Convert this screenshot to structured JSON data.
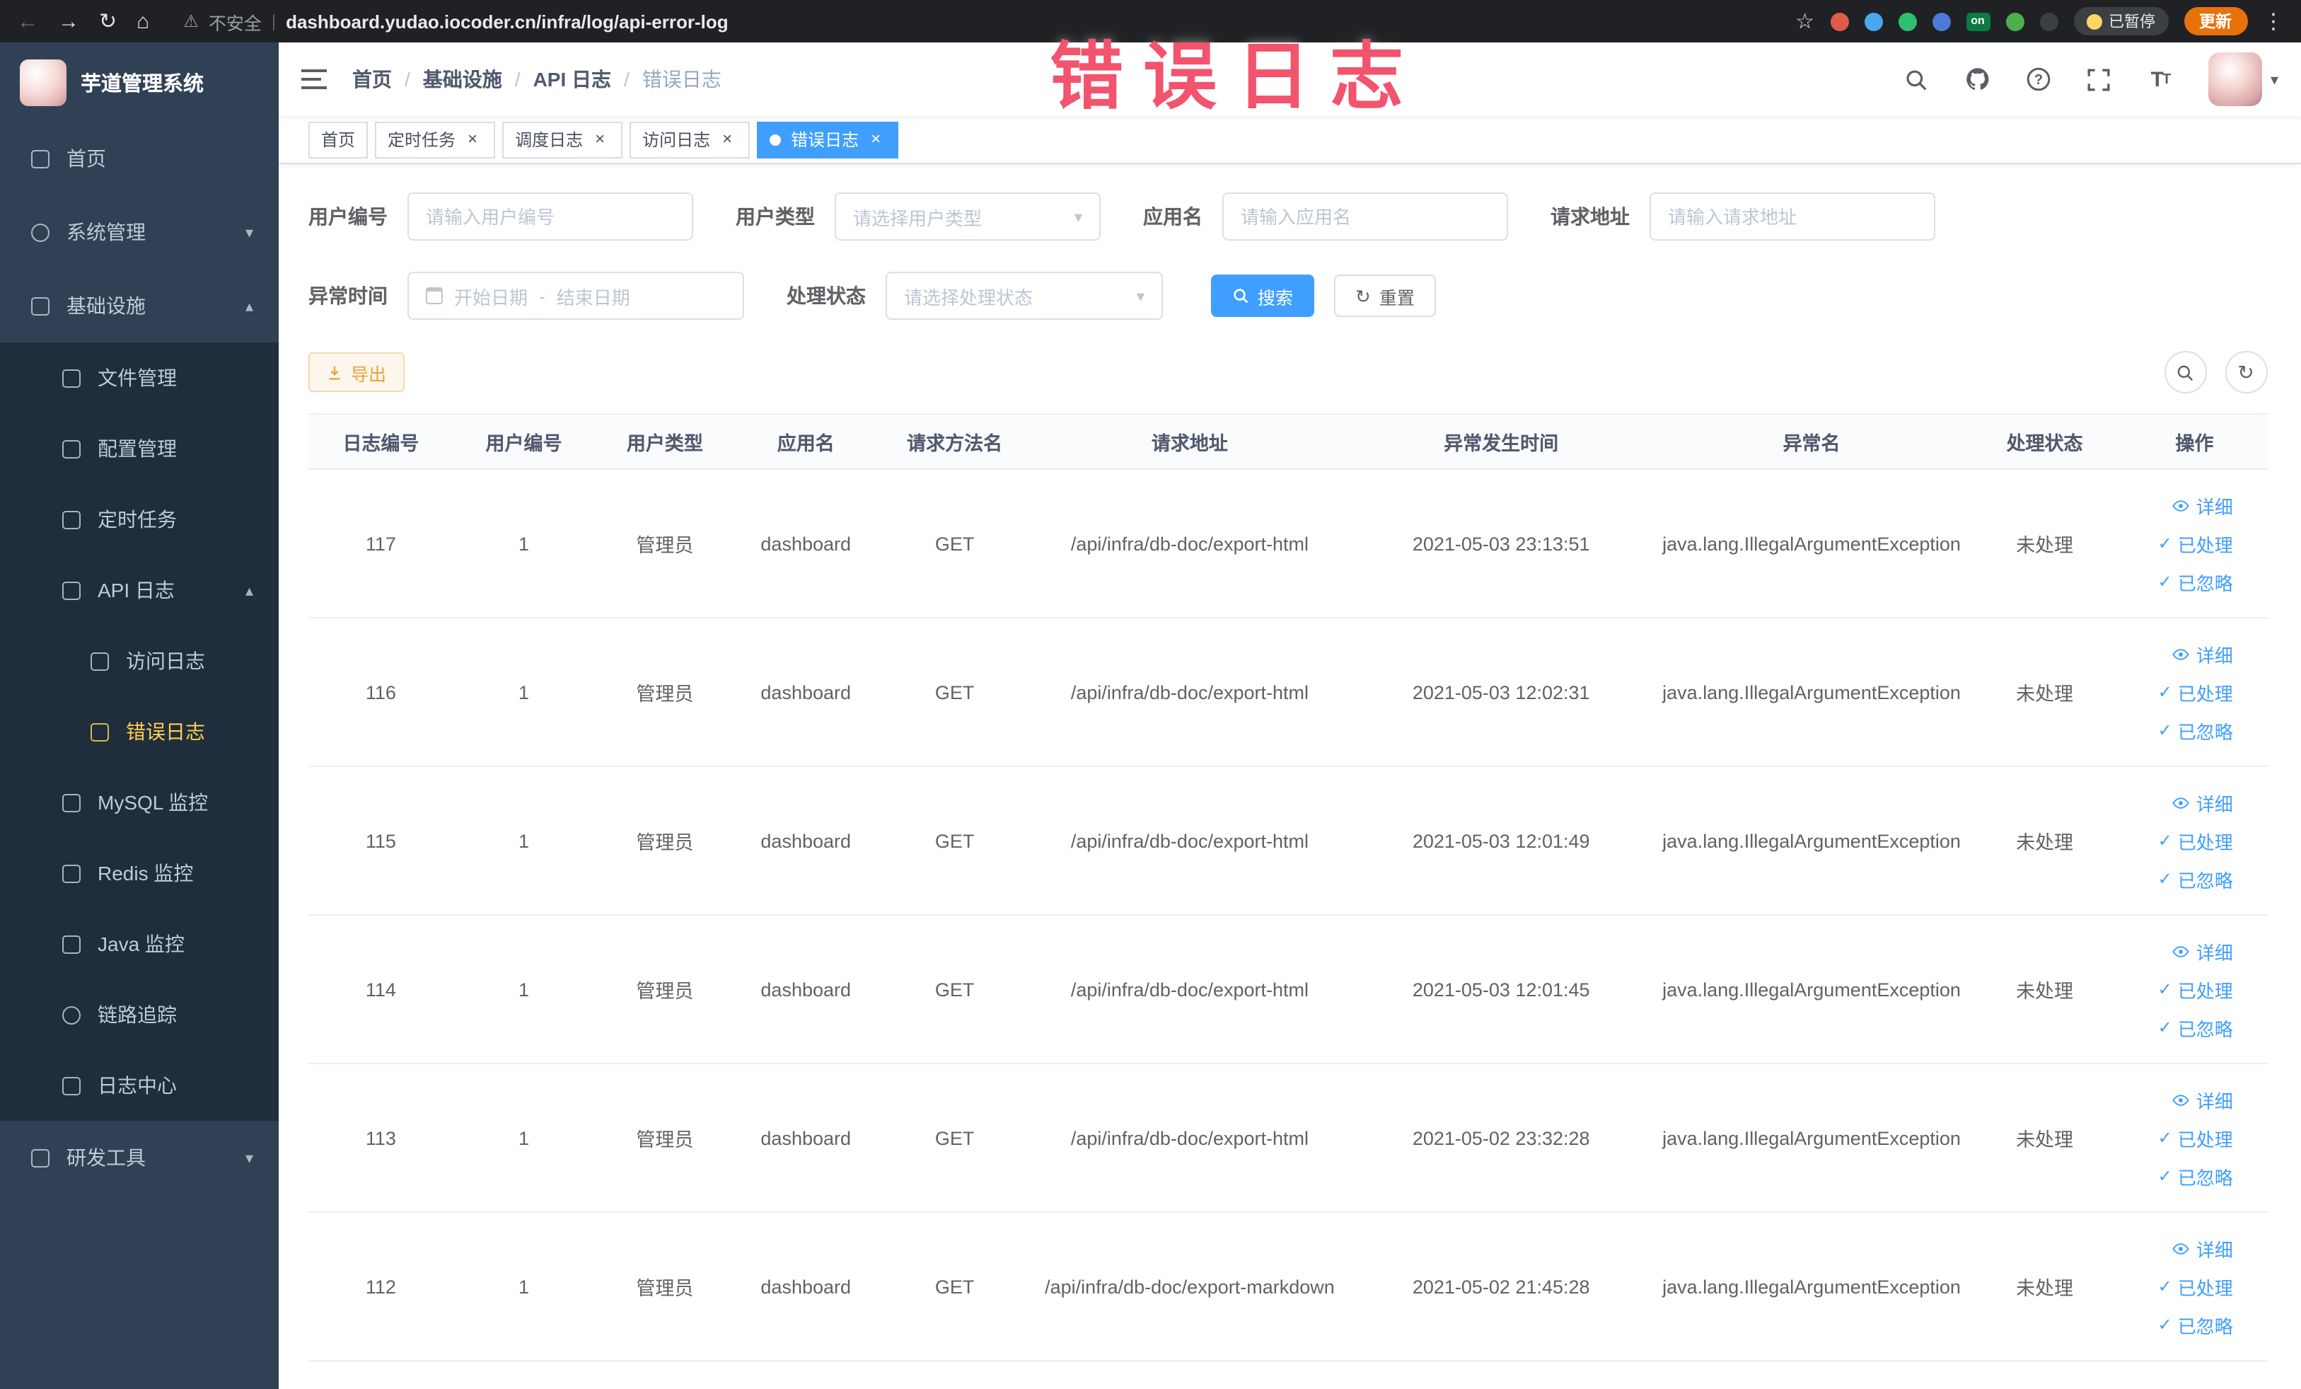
{
  "browser": {
    "security_label": "不安全",
    "url": "dashboard.yudao.iocoder.cn/infra/log/api-error-log",
    "paused_badge": "已暂停",
    "update_button": "更新",
    "extension_on_badge": "on"
  },
  "annotation": {
    "text": "错误日志",
    "color": "#f2536d"
  },
  "sidebar": {
    "logo_title": "芋道管理系统",
    "items": [
      {
        "label": "首页"
      },
      {
        "label": "系统管理"
      },
      {
        "label": "基础设施"
      },
      {
        "label": "文件管理"
      },
      {
        "label": "配置管理"
      },
      {
        "label": "定时任务"
      },
      {
        "label": "API 日志"
      },
      {
        "label": "访问日志"
      },
      {
        "label": "错误日志"
      },
      {
        "label": "MySQL 监控"
      },
      {
        "label": "Redis 监控"
      },
      {
        "label": "Java 监控"
      },
      {
        "label": "链路追踪"
      },
      {
        "label": "日志中心"
      },
      {
        "label": "研发工具"
      }
    ]
  },
  "header": {
    "breadcrumbs": [
      "首页",
      "基础设施",
      "API 日志",
      "错误日志"
    ]
  },
  "tabs": [
    {
      "label": "首页"
    },
    {
      "label": "定时任务"
    },
    {
      "label": "调度日志"
    },
    {
      "label": "访问日志"
    },
    {
      "label": "错误日志"
    }
  ],
  "filters": {
    "user_id_label": "用户编号",
    "user_id_placeholder": "请输入用户编号",
    "user_type_label": "用户类型",
    "user_type_placeholder": "请选择用户类型",
    "app_name_label": "应用名",
    "app_name_placeholder": "请输入应用名",
    "request_url_label": "请求地址",
    "request_url_placeholder": "请输入请求地址",
    "exception_time_label": "异常时间",
    "date_start_placeholder": "开始日期",
    "date_separator": "-",
    "date_end_placeholder": "结束日期",
    "process_status_label": "处理状态",
    "process_status_placeholder": "请选择处理状态",
    "search_button": "搜索",
    "reset_button": "重置"
  },
  "toolbar": {
    "export_button": "导出"
  },
  "table": {
    "columns": [
      "日志编号",
      "用户编号",
      "用户类型",
      "应用名",
      "请求方法名",
      "请求地址",
      "异常发生时间",
      "异常名",
      "处理状态",
      "操作"
    ],
    "actions": {
      "detail": "详细",
      "processed": "已处理",
      "ignored": "已忽略"
    },
    "rows": [
      {
        "id": "117",
        "user_id": "1",
        "user_type": "管理员",
        "app": "dashboard",
        "method": "GET",
        "url": "/api/infra/db-doc/export-html",
        "time": "2021-05-03 23:13:51",
        "exception": "java.lang.IllegalArgumentException",
        "status": "未处理"
      },
      {
        "id": "116",
        "user_id": "1",
        "user_type": "管理员",
        "app": "dashboard",
        "method": "GET",
        "url": "/api/infra/db-doc/export-html",
        "time": "2021-05-03 12:02:31",
        "exception": "java.lang.IllegalArgumentException",
        "status": "未处理"
      },
      {
        "id": "115",
        "user_id": "1",
        "user_type": "管理员",
        "app": "dashboard",
        "method": "GET",
        "url": "/api/infra/db-doc/export-html",
        "time": "2021-05-03 12:01:49",
        "exception": "java.lang.IllegalArgumentException",
        "status": "未处理"
      },
      {
        "id": "114",
        "user_id": "1",
        "user_type": "管理员",
        "app": "dashboard",
        "method": "GET",
        "url": "/api/infra/db-doc/export-html",
        "time": "2021-05-03 12:01:45",
        "exception": "java.lang.IllegalArgumentException",
        "status": "未处理"
      },
      {
        "id": "113",
        "user_id": "1",
        "user_type": "管理员",
        "app": "dashboard",
        "method": "GET",
        "url": "/api/infra/db-doc/export-html",
        "time": "2021-05-02 23:32:28",
        "exception": "java.lang.IllegalArgumentException",
        "status": "未处理"
      },
      {
        "id": "112",
        "user_id": "1",
        "user_type": "管理员",
        "app": "dashboard",
        "method": "GET",
        "url": "/api/infra/db-doc/export-markdown",
        "time": "2021-05-02 21:45:28",
        "exception": "java.lang.IllegalArgumentException",
        "status": "未处理"
      }
    ]
  }
}
